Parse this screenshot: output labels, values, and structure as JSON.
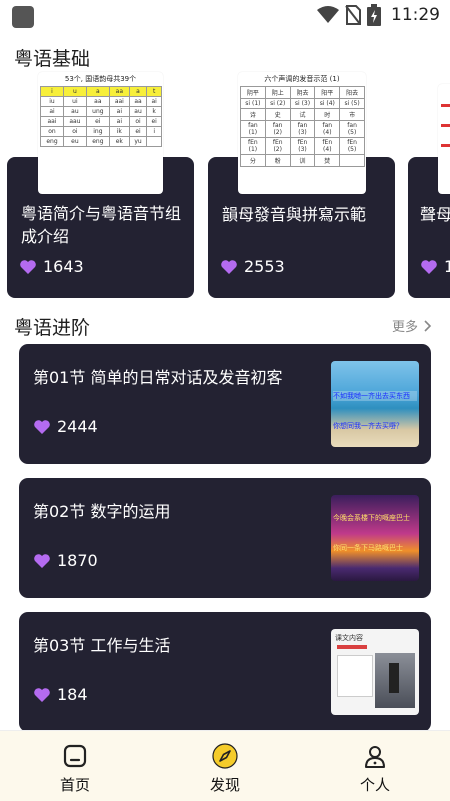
{
  "statusbar": {
    "time": "11:29"
  },
  "sections": {
    "basics_title": "粤语基础",
    "advanced_title": "粤语进阶",
    "more_label": "更多"
  },
  "basics": [
    {
      "title": "粤语简介与粤语音节组成介绍",
      "likes": "1643"
    },
    {
      "title": "韻母發音與拼寫示範",
      "likes": "2553"
    },
    {
      "title": "聲母",
      "likes": "1"
    }
  ],
  "thumb1": {
    "heading": "53个, 国语韵母共39个",
    "rows": [
      [
        "i",
        "u",
        "a",
        "aa",
        "a",
        "t"
      ],
      [
        "iu",
        "ui",
        "aa",
        "aai",
        "aa",
        "ai"
      ],
      [
        "ai",
        "au",
        "ung",
        "ai",
        "au",
        "k"
      ],
      [
        "aai",
        "aau",
        "ei",
        "ai",
        "oi",
        "ei"
      ],
      [
        "on",
        "oi",
        "ing",
        "ik",
        "ei",
        "i"
      ],
      [
        "eng",
        "eu",
        "eng",
        "ek",
        "yu",
        ""
      ]
    ]
  },
  "thumb2": {
    "heading": "六个声调的发音示范 (1)",
    "rows": [
      [
        "阴平",
        "阴上",
        "阴去",
        "阳平",
        "阳去"
      ],
      [
        "si (1)",
        "si (2)",
        "si (3)",
        "si (4)",
        "si (5)"
      ],
      [
        "诗",
        "史",
        "试",
        "时",
        "市"
      ],
      [
        "fan (1)",
        "fan (2)",
        "fan (3)",
        "fan (4)",
        "fan (5)"
      ],
      [
        "fEn (1)",
        "fEn (2)",
        "fEn (3)",
        "fEn (4)",
        "fEn (5)"
      ],
      [
        "分",
        "粉",
        "训",
        "焚",
        ""
      ]
    ]
  },
  "lessons": [
    {
      "title": "第01节 简单的日常对话及发音初客",
      "likes": "2444",
      "thumb_text": [
        "不如我哋一齐出去买东西",
        "你想同我一齐去买嘢？"
      ]
    },
    {
      "title": "第02节 数字的运用",
      "likes": "1870",
      "thumb_text": [
        "今晚会系楼下的嘅座巴士",
        "你同一条下马路嘅巴士"
      ]
    },
    {
      "title": "第03节 工作与生活",
      "likes": "184",
      "thumb_text": [
        "课文内容"
      ]
    }
  ],
  "nav": [
    {
      "label": "首页",
      "icon": "home-icon"
    },
    {
      "label": "发现",
      "icon": "compass-icon"
    },
    {
      "label": "个人",
      "icon": "person-icon"
    }
  ],
  "colors": {
    "card_bg": "#232232",
    "heart": "#b46bf0",
    "nav_bg": "#fdf9ec",
    "compass": "#f5cc2a"
  }
}
